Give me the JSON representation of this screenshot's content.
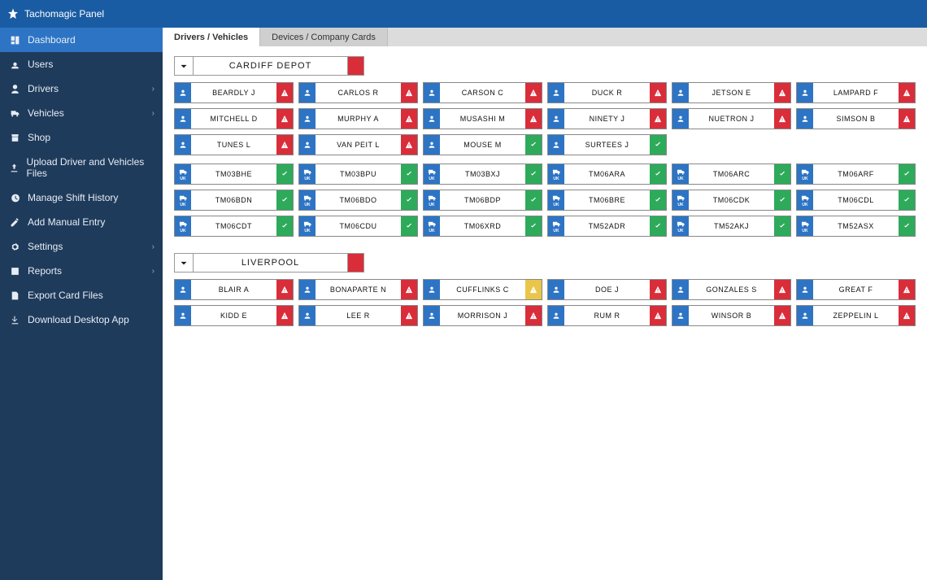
{
  "brand": "Tachomagic Panel",
  "sidebar": [
    {
      "icon": "dashboard",
      "label": "Dashboard",
      "active": true
    },
    {
      "icon": "users",
      "label": "Users"
    },
    {
      "icon": "drivers",
      "label": "Drivers",
      "expandable": true
    },
    {
      "icon": "truck",
      "label": "Vehicles",
      "expandable": true
    },
    {
      "icon": "shop",
      "label": "Shop"
    },
    {
      "icon": "upload",
      "label": "Upload Driver and Vehicles Files"
    },
    {
      "icon": "history",
      "label": "Manage Shift History"
    },
    {
      "icon": "edit",
      "label": "Add Manual Entry"
    },
    {
      "icon": "settings",
      "label": "Settings",
      "expandable": true
    },
    {
      "icon": "reports",
      "label": "Reports",
      "expandable": true
    },
    {
      "icon": "export",
      "label": "Export Card Files"
    },
    {
      "icon": "download",
      "label": "Download Desktop App"
    }
  ],
  "tabs": [
    {
      "label": "Drivers / Vehicles",
      "active": true
    },
    {
      "label": "Devices / Company Cards"
    }
  ],
  "depots": [
    {
      "name": "CARDIFF DEPOT",
      "status": "red",
      "drivers": [
        {
          "name": "BEARDLY J",
          "status": "red"
        },
        {
          "name": "CARLOS R",
          "status": "red"
        },
        {
          "name": "CARSON C",
          "status": "red"
        },
        {
          "name": "DUCK R",
          "status": "red"
        },
        {
          "name": "JETSON E",
          "status": "red"
        },
        {
          "name": "LAMPARD F",
          "status": "red"
        },
        {
          "name": "MITCHELL D",
          "status": "red"
        },
        {
          "name": "MURPHY A",
          "status": "red"
        },
        {
          "name": "MUSASHI M",
          "status": "red"
        },
        {
          "name": "NINETY J",
          "status": "red"
        },
        {
          "name": "NUETRON J",
          "status": "red"
        },
        {
          "name": "SIMSON B",
          "status": "red"
        },
        {
          "name": "TUNES L",
          "status": "red"
        },
        {
          "name": "VAN PEIT L",
          "status": "red"
        },
        {
          "name": "MOUSE M",
          "status": "green"
        },
        {
          "name": "SURTEES J",
          "status": "green"
        }
      ],
      "vehicles": [
        {
          "reg": "TM03BHE",
          "status": "green"
        },
        {
          "reg": "TM03BPU",
          "status": "green"
        },
        {
          "reg": "TM03BXJ",
          "status": "green"
        },
        {
          "reg": "TM06ARA",
          "status": "green"
        },
        {
          "reg": "TM06ARC",
          "status": "green"
        },
        {
          "reg": "TM06ARF",
          "status": "green"
        },
        {
          "reg": "TM06BDN",
          "status": "green"
        },
        {
          "reg": "TM06BDO",
          "status": "green"
        },
        {
          "reg": "TM06BDP",
          "status": "green"
        },
        {
          "reg": "TM06BRE",
          "status": "green"
        },
        {
          "reg": "TM06CDK",
          "status": "green"
        },
        {
          "reg": "TM06CDL",
          "status": "green"
        },
        {
          "reg": "TM06CDT",
          "status": "green"
        },
        {
          "reg": "TM06CDU",
          "status": "green"
        },
        {
          "reg": "TM06XRD",
          "status": "green"
        },
        {
          "reg": "TM52ADR",
          "status": "green"
        },
        {
          "reg": "TM52AKJ",
          "status": "green"
        },
        {
          "reg": "TM52ASX",
          "status": "green"
        }
      ]
    },
    {
      "name": "LIVERPOOL",
      "status": "red",
      "drivers": [
        {
          "name": "BLAIR A",
          "status": "red"
        },
        {
          "name": "BONAPARTE N",
          "status": "red"
        },
        {
          "name": "CUFFLINKS C",
          "status": "yellow"
        },
        {
          "name": "DOE J",
          "status": "red"
        },
        {
          "name": "GONZALES S",
          "status": "red"
        },
        {
          "name": "GREAT F",
          "status": "red"
        },
        {
          "name": "KIDD E",
          "status": "red"
        },
        {
          "name": "LEE R",
          "status": "red"
        },
        {
          "name": "MORRISON J",
          "status": "red"
        },
        {
          "name": "RUM R",
          "status": "red"
        },
        {
          "name": "WINSOR B",
          "status": "red"
        },
        {
          "name": "ZEPPELIN L",
          "status": "red"
        }
      ],
      "vehicles": []
    }
  ],
  "labels": {
    "uk": "UK"
  }
}
